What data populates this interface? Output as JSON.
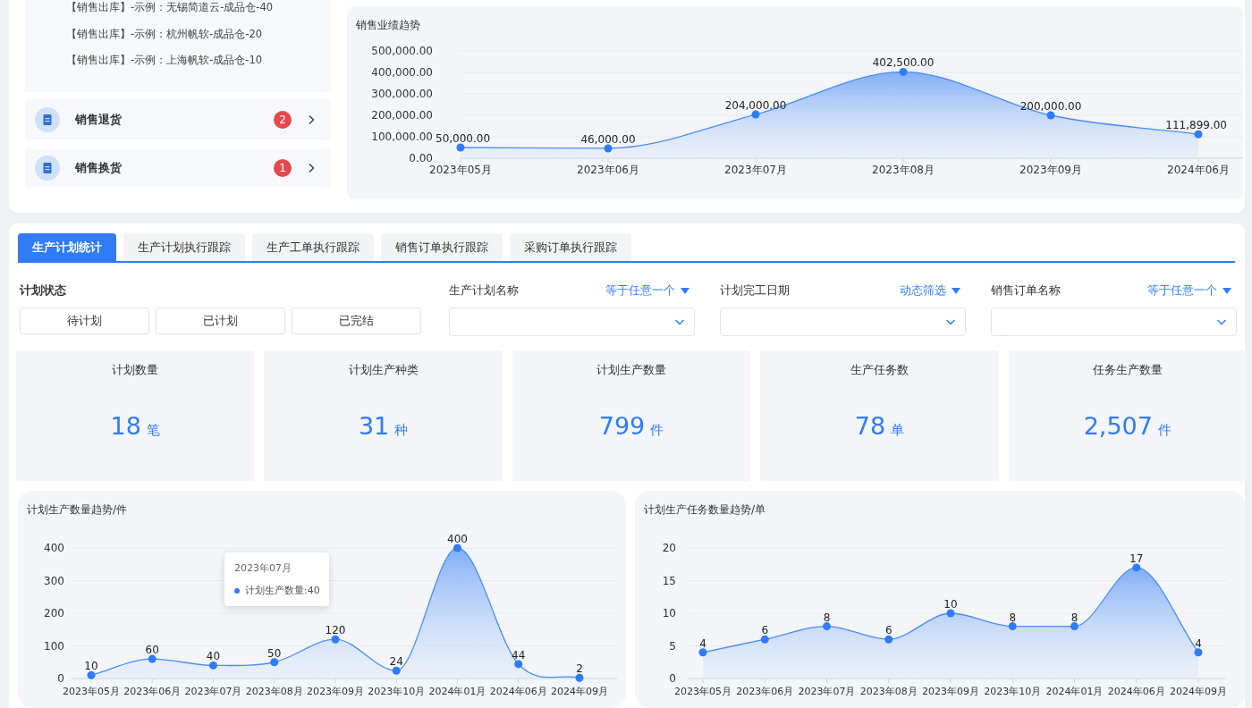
{
  "outbound_list": [
    "【销售出库】-示例：无锡简道云-成品仓-40",
    "【销售出库】-示例：杭州帆软-成品仓-20",
    "【销售出库】-示例：上海帆软-成品仓-10"
  ],
  "task_rows": [
    {
      "label": "销售退货",
      "count": "2"
    },
    {
      "label": "销售换货",
      "count": "1"
    }
  ],
  "sales_chart": {
    "title": "销售业绩趋势",
    "chart_data": {
      "type": "area",
      "categories": [
        "2023年05月",
        "2023年06月",
        "2023年07月",
        "2023年08月",
        "2023年09月",
        "2024年06月"
      ],
      "values": [
        50000,
        46000,
        204000,
        402500,
        200000,
        111899
      ],
      "ylim": [
        0,
        500000
      ],
      "yticks": [
        {
          "value": 0,
          "label": "0.00"
        },
        {
          "value": 100000,
          "label": "100,000.00"
        },
        {
          "value": 200000,
          "label": "200,000.00"
        },
        {
          "value": 300000,
          "label": "300,000.00"
        },
        {
          "value": 400000,
          "label": "400,000.00"
        },
        {
          "value": 500000,
          "label": "500,000.00"
        }
      ],
      "grid": true,
      "value_labels": [
        "50,000.00",
        "46,000.00",
        "204,000.00",
        "402,500.00",
        "200,000.00",
        "111,899.00"
      ]
    }
  },
  "tabs": [
    {
      "label": "生产计划统计",
      "selected": true
    },
    {
      "label": "生产计划执行跟踪",
      "selected": false
    },
    {
      "label": "生产工单执行跟踪",
      "selected": false
    },
    {
      "label": "销售订单执行跟踪",
      "selected": false
    },
    {
      "label": "采购订单执行跟踪",
      "selected": false
    }
  ],
  "status_filter": {
    "label": "计划状态",
    "options": [
      {
        "label": "待计划",
        "selected": false
      },
      {
        "label": "已计划",
        "selected": false
      },
      {
        "label": "已完结",
        "selected": false
      }
    ]
  },
  "filters": [
    {
      "label": "生产计划名称",
      "mode": "等于任意一个"
    },
    {
      "label": "计划完工日期",
      "mode": "动态筛选"
    },
    {
      "label": "销售订单名称",
      "mode": "等于任意一个"
    }
  ],
  "kpis": [
    {
      "label": "计划数量",
      "value": "18",
      "unit": "笔"
    },
    {
      "label": "计划生产种类",
      "value": "31",
      "unit": "种"
    },
    {
      "label": "计划生产数量",
      "value": "799",
      "unit": "件"
    },
    {
      "label": "生产任务数",
      "value": "78",
      "unit": "单"
    },
    {
      "label": "任务生产数量",
      "value": "2,507",
      "unit": "件"
    }
  ],
  "charts": [
    {
      "title": "计划生产数量趋势/件",
      "tooltip": {
        "title": "2023年07月",
        "text": "计划生产数量:40"
      },
      "chart_data": {
        "type": "area",
        "categories": [
          "2023年05月",
          "2023年06月",
          "2023年07月",
          "2023年08月",
          "2023年09月",
          "2023年10月",
          "2024年01月",
          "2024年06月",
          "2024年09月"
        ],
        "values": [
          10,
          60,
          40,
          50,
          120,
          24,
          400,
          44,
          2
        ],
        "ylim": [
          0,
          400
        ],
        "yticks": [
          0,
          100,
          200,
          300,
          400
        ],
        "grid": true,
        "data_labels": true
      }
    },
    {
      "title": "计划生产任务数量趋势/单",
      "chart_data": {
        "type": "area",
        "categories": [
          "2023年05月",
          "2023年06月",
          "2023年07月",
          "2023年08月",
          "2023年09月",
          "2023年10月",
          "2024年01月",
          "2024年06月",
          "2024年09月"
        ],
        "values": [
          4,
          6,
          8,
          6,
          10,
          8,
          8,
          17,
          4
        ],
        "ylim": [
          0,
          20
        ],
        "yticks": [
          0,
          5,
          10,
          15,
          20
        ],
        "grid": true,
        "data_labels": true
      }
    }
  ]
}
